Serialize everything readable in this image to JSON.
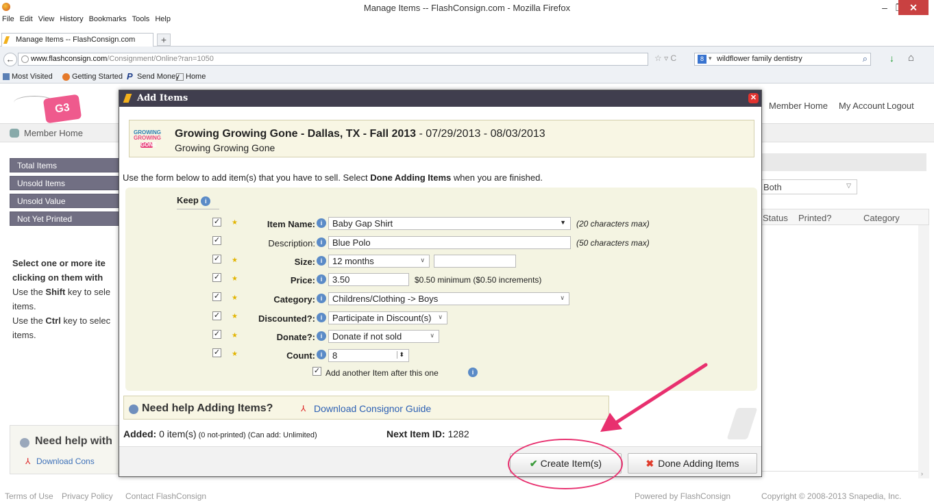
{
  "window": {
    "title": "Manage Items -- FlashConsign.com - Mozilla Firefox",
    "minimize": "–",
    "maximize": "❐",
    "close": "✕"
  },
  "menu": [
    "File",
    "Edit",
    "View",
    "History",
    "Bookmarks",
    "Tools",
    "Help"
  ],
  "tab": {
    "label": "Manage Items -- FlashConsign.com",
    "new_tab": "+"
  },
  "nav": {
    "url_host": "www.flashconsign.com",
    "url_path": "/Consignment/Online?ran=1050",
    "search_value": "wildflower family dentistry"
  },
  "bookmarks": [
    "Most Visited",
    "Getting Started",
    "Send Money",
    "Home"
  ],
  "page": {
    "top_links": [
      "Member Home",
      "My Account",
      "Logout"
    ],
    "member_bar": "Member Home",
    "side_items": [
      "Total Items",
      "Unsold Items",
      "Unsold Value",
      "Not Yet Printed"
    ],
    "side_text": {
      "heading1": "Select one or more ite",
      "heading2": "clicking on them with",
      "line3_pre": "Use the ",
      "line3_key": "Shift",
      "line3_post": " key to sele",
      "line4": "items.",
      "line5_pre": "Use the ",
      "line5_key": "Ctrl",
      "line5_post": " key to selec",
      "line6": "items."
    },
    "help_title": "Need help with",
    "help_link": "Download Cons",
    "filter_value": "Both",
    "columns": [
      "Status",
      "Printed?",
      "Category"
    ],
    "footer_links": [
      "Terms of Use",
      "Privacy Policy",
      "Contact FlashConsign"
    ],
    "powered": "Powered by FlashConsign",
    "copyright": "Copyright © 2008-2013 Snapedia, Inc."
  },
  "modal": {
    "title": "Add Items",
    "event": {
      "name": "Growing Growing Gone - Dallas, TX - Fall 2013",
      "dates": " - 07/29/2013 - 08/03/2013",
      "org": "Growing Growing Gone",
      "logo_line1": "GROWING",
      "logo_line2": "GROWING",
      "logo_line3": "GONE"
    },
    "intro_pre": "Use the form below to add item(s) that you have to sell. Select ",
    "intro_bold": "Done Adding Items",
    "intro_post": " when you are finished.",
    "keep_label": "Keep",
    "fields": {
      "item_name": {
        "label": "Item Name:",
        "value": "Baby Gap Shirt",
        "note": "(20 characters max)"
      },
      "description": {
        "label": "Description:",
        "value": "Blue Polo",
        "note": "(50 characters max)"
      },
      "size": {
        "label": "Size:",
        "value": "12 months",
        "extra": ""
      },
      "price": {
        "label": "Price:",
        "value": "3.50",
        "note": "$0.50 minimum ($0.50 increments)"
      },
      "category": {
        "label": "Category:",
        "value": "Childrens/Clothing -> Boys"
      },
      "discounted": {
        "label": "Discounted?:",
        "value": "Participate in Discount(s)"
      },
      "donate": {
        "label": "Donate?:",
        "value": "Donate if not sold"
      },
      "count": {
        "label": "Count:",
        "value": "8"
      }
    },
    "add_another": "Add another Item after this one",
    "help_title": "Need help Adding Items?",
    "help_link": "Download Consignor Guide",
    "added_label": "Added:",
    "added_value": " 0 item(s)",
    "added_small": " (0 not-printed) (Can add: Unlimited)",
    "next_label": "Next Item ID:",
    "next_value": " 1282",
    "create_button": "Create Item(s)",
    "done_button": "Done Adding Items"
  },
  "colors": {
    "accent_pink": "#e8306f",
    "header": "#403e4e",
    "form_bg": "#f4f4e2"
  }
}
